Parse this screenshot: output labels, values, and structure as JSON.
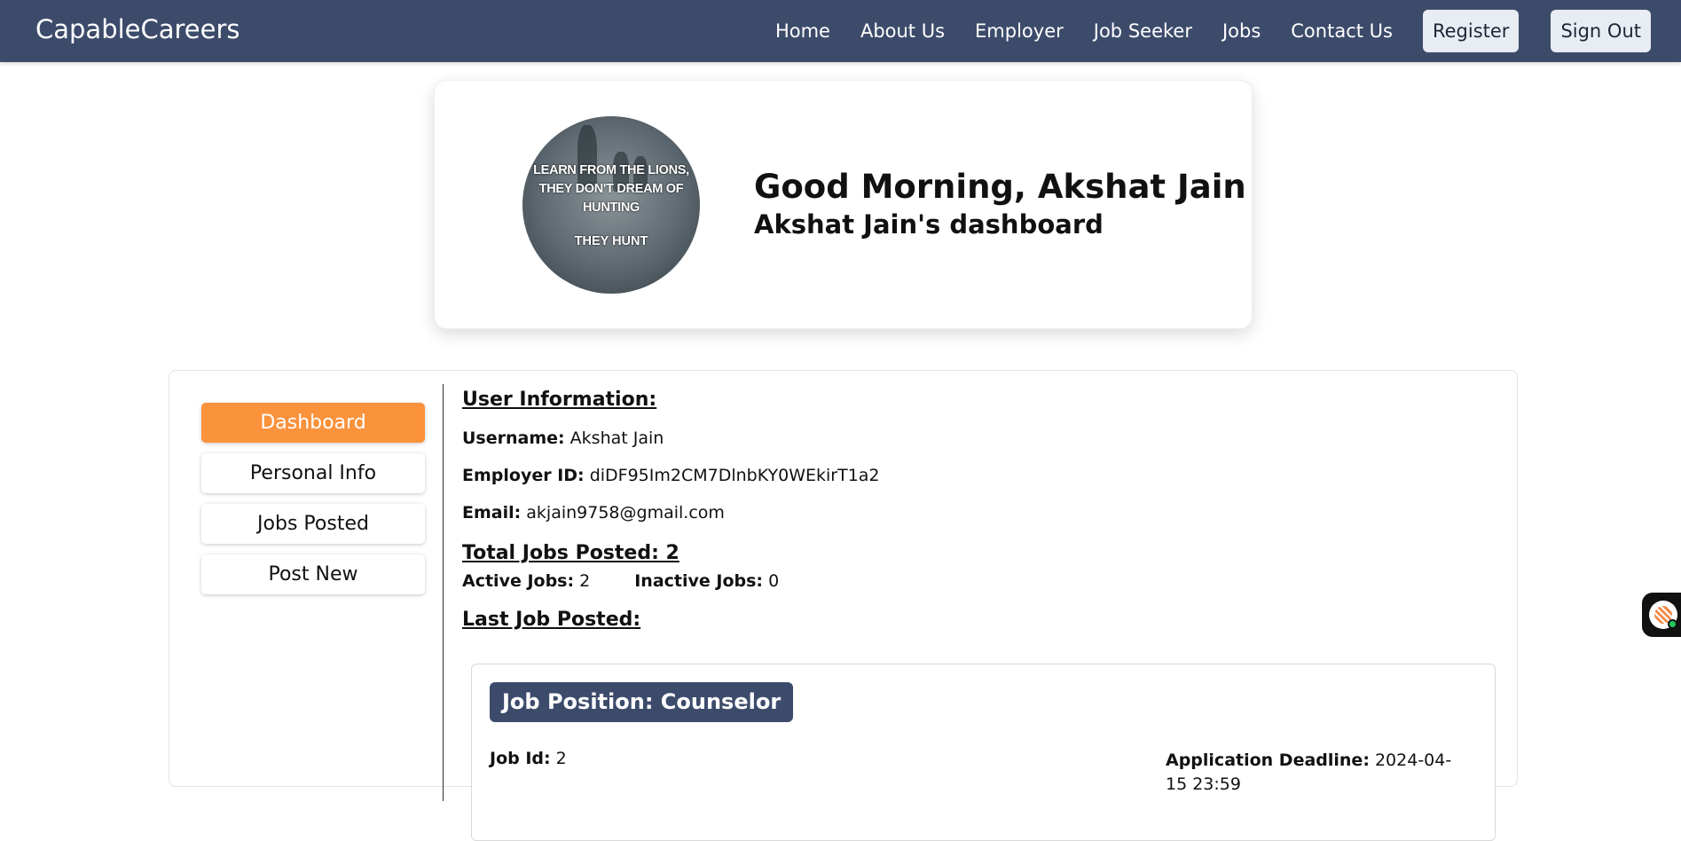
{
  "navbar": {
    "brand": "CapableCareers",
    "links": [
      "Home",
      "About Us",
      "Employer",
      "Job Seeker",
      "Jobs",
      "Contact Us"
    ],
    "register_label": "Register",
    "signout_label": "Sign Out"
  },
  "greeting": {
    "avatar_text_line1": "LEARN FROM THE LIONS,",
    "avatar_text_line2": "THEY DON'T DREAM OF",
    "avatar_text_line3": "HUNTING",
    "avatar_text_line4": "THEY HUNT",
    "title": "Good Morning, Akshat Jain",
    "subtitle": "Akshat Jain's dashboard"
  },
  "sidebar": {
    "items": [
      {
        "label": "Dashboard",
        "active": true
      },
      {
        "label": "Personal Info",
        "active": false
      },
      {
        "label": "Jobs Posted",
        "active": false
      },
      {
        "label": "Post New",
        "active": false
      }
    ]
  },
  "user_info": {
    "heading": "User Information:",
    "username_label": "Username:",
    "username": "Akshat Jain",
    "employer_id_label": "Employer ID:",
    "employer_id": "diDF95Im2CM7DlnbKY0WEkirT1a2",
    "email_label": "Email:",
    "email": "akjain9758@gmail.com"
  },
  "jobs_summary": {
    "heading": "Total Jobs Posted: 2",
    "active_label": "Active Jobs:",
    "active_count": "2",
    "inactive_label": "Inactive Jobs:",
    "inactive_count": "0"
  },
  "last_job": {
    "heading": "Last Job Posted:",
    "position": "Job Position: Counselor",
    "job_id_label": "Job Id:",
    "job_id": "2",
    "deadline_label": "Application Deadline:",
    "deadline": "2024-04-15 23:59"
  },
  "colors": {
    "navbar": "#3d4b6b",
    "accent": "#fb923c",
    "status_online": "#22c55e"
  }
}
